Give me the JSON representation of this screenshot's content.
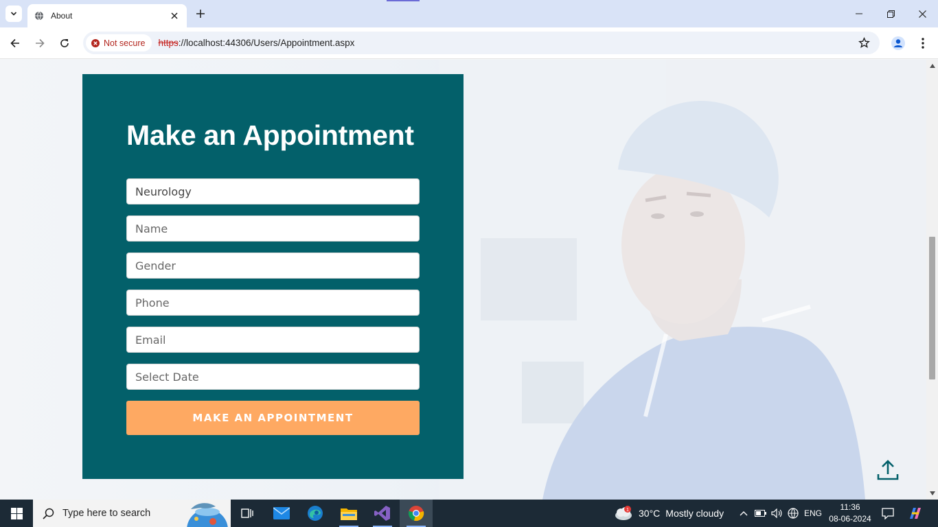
{
  "browser": {
    "tab": {
      "title": "About"
    },
    "address_bar": {
      "security_label": "Not secure",
      "url_scheme": "https",
      "url_rest": "://localhost:44306/Users/Appointment.aspx"
    }
  },
  "form": {
    "title": "Make an Appointment",
    "fields": {
      "department": {
        "value": "Neurology"
      },
      "name": {
        "placeholder": "Name"
      },
      "gender": {
        "placeholder": "Gender"
      },
      "phone": {
        "placeholder": "Phone"
      },
      "email": {
        "placeholder": "Email"
      },
      "date": {
        "placeholder": "Select Date"
      }
    },
    "submit_label": "MAKE AN APPOINTMENT"
  },
  "taskbar": {
    "search_placeholder": "Type here to search",
    "weather": {
      "temperature": "30°C",
      "condition": "Mostly cloudy",
      "badge": "1"
    },
    "language": "ENG",
    "clock": {
      "time": "11:36",
      "date": "08-06-2024"
    }
  },
  "colors": {
    "form_background": "#03606a",
    "button": "#fea962",
    "tab_strip": "#d9e3f7",
    "taskbar": "#1c2a36",
    "not_secure": "#b3261e"
  }
}
